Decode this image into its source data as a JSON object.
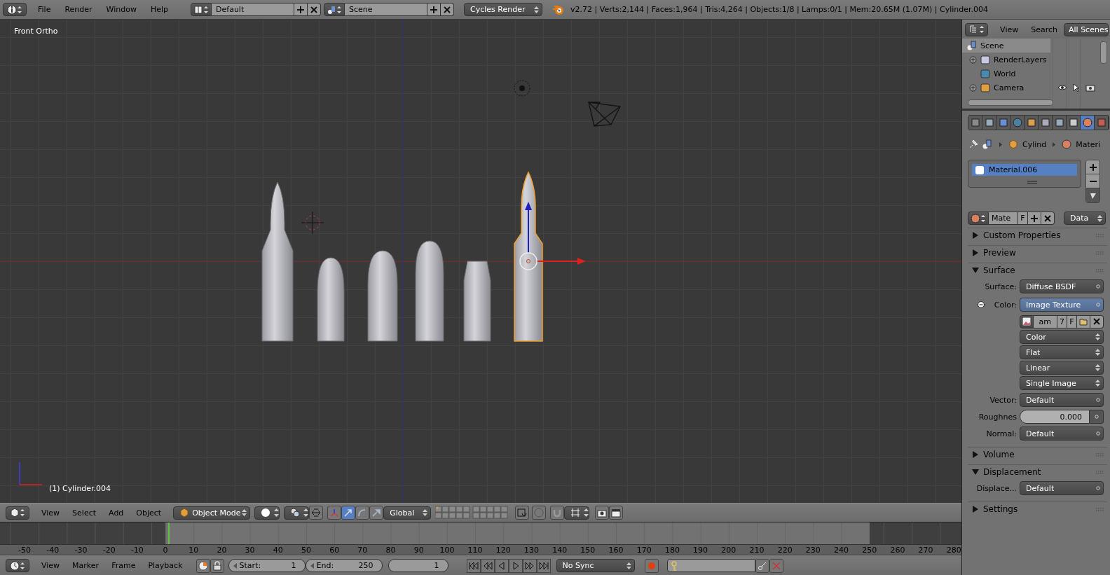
{
  "topbar": {
    "menus": [
      "File",
      "Render",
      "Window",
      "Help"
    ],
    "layout": "Default",
    "scene": "Scene",
    "engine": "Cycles Render",
    "stats": "v2.72 | Verts:2,144 | Faces:1,964 | Tris:4,264 | Objects:1/8 | Lamps:0/1 | Mem:20.65M (1.07M) | Cylinder.004"
  },
  "viewport": {
    "view_name": "Front Ortho",
    "active_object": "(1) Cylinder.004",
    "objects": [
      {
        "kind": "rifle",
        "selected": false
      },
      {
        "kind": "pistol",
        "selected": false
      },
      {
        "kind": "pistol",
        "selected": false
      },
      {
        "kind": "pistol",
        "selected": false
      },
      {
        "kind": "pistol",
        "selected": false
      },
      {
        "kind": "rifle",
        "selected": true
      }
    ]
  },
  "view3d_header": {
    "menus": [
      "View",
      "Select",
      "Add",
      "Object"
    ],
    "mode": "Object Mode",
    "orientation": "Global",
    "manipulators": [
      {
        "kind": "translate",
        "selected": true
      },
      {
        "kind": "rotate",
        "selected": false
      },
      {
        "kind": "scale",
        "selected": false
      }
    ]
  },
  "timeline": {
    "ticks": [
      "-50",
      "-40",
      "-30",
      "-20",
      "-10",
      "0",
      "10",
      "20",
      "30",
      "40",
      "50",
      "60",
      "70",
      "80",
      "90",
      "100",
      "110",
      "120",
      "130",
      "140",
      "150",
      "160",
      "170",
      "180",
      "190",
      "200",
      "210",
      "220",
      "230",
      "240",
      "250",
      "260",
      "270",
      "280"
    ],
    "menus": [
      "View",
      "Marker",
      "Frame",
      "Playback"
    ],
    "start_label": "Start:",
    "start": "1",
    "end_label": "End:",
    "end": "250",
    "current": "1",
    "sync": "No Sync"
  },
  "outliner": {
    "menus": [
      "View",
      "Search"
    ],
    "display": "All Scenes",
    "tree": [
      {
        "name": "Scene",
        "kind": "scene",
        "selected": true,
        "children": [
          {
            "name": "RenderLayers",
            "kind": "renderlayers",
            "selected": false,
            "expanded": false
          },
          {
            "name": "World",
            "kind": "world",
            "selected": false
          },
          {
            "name": "Camera",
            "kind": "camera",
            "selected": false,
            "expanded": false
          }
        ]
      }
    ]
  },
  "properties": {
    "tabs": [
      {
        "kind": "render",
        "selected": false
      },
      {
        "kind": "layers",
        "selected": false
      },
      {
        "kind": "scene",
        "selected": false
      },
      {
        "kind": "world",
        "selected": false
      },
      {
        "kind": "object",
        "selected": false
      },
      {
        "kind": "constraints",
        "selected": false
      },
      {
        "kind": "modifiers",
        "selected": false
      },
      {
        "kind": "data",
        "selected": false
      },
      {
        "kind": "material",
        "selected": true
      },
      {
        "kind": "texture",
        "selected": false
      }
    ],
    "path": [
      "Cylind",
      "Materi"
    ],
    "slots": [
      {
        "name": "Material.006",
        "selected": true
      }
    ],
    "material_field": "Mate",
    "fake_user": "F",
    "link": "Data",
    "panels": [
      {
        "title": "Custom Properties",
        "expanded": false
      },
      {
        "title": "Preview",
        "expanded": false
      },
      {
        "title": "Surface",
        "expanded": true,
        "rows": [
          {
            "kind": "socket",
            "label": "Surface:",
            "value": "Diffuse BSDF",
            "linked": false
          },
          {
            "kind": "socket",
            "label": "Color:",
            "value": "Image Texture",
            "linked": true
          },
          {
            "kind": "image",
            "fields": [
              "am",
              "7",
              "F"
            ]
          },
          {
            "kind": "dropdown",
            "value": "Color"
          },
          {
            "kind": "dropdown",
            "value": "Flat"
          },
          {
            "kind": "dropdown",
            "value": "Linear"
          },
          {
            "kind": "dropdown",
            "value": "Single Image"
          },
          {
            "kind": "socket",
            "label": "Vector:",
            "value": "Default",
            "linked": false
          },
          {
            "kind": "number",
            "label": "Roughnes",
            "value": "0.000"
          },
          {
            "kind": "socket",
            "label": "Normal:",
            "value": "Default",
            "linked": false
          }
        ]
      },
      {
        "title": "Volume",
        "expanded": false
      },
      {
        "title": "Displacement",
        "expanded": true,
        "rows": [
          {
            "kind": "socket",
            "label": "Displace...",
            "value": "Default",
            "linked": false
          }
        ]
      },
      {
        "title": "Settings",
        "expanded": false
      }
    ]
  }
}
